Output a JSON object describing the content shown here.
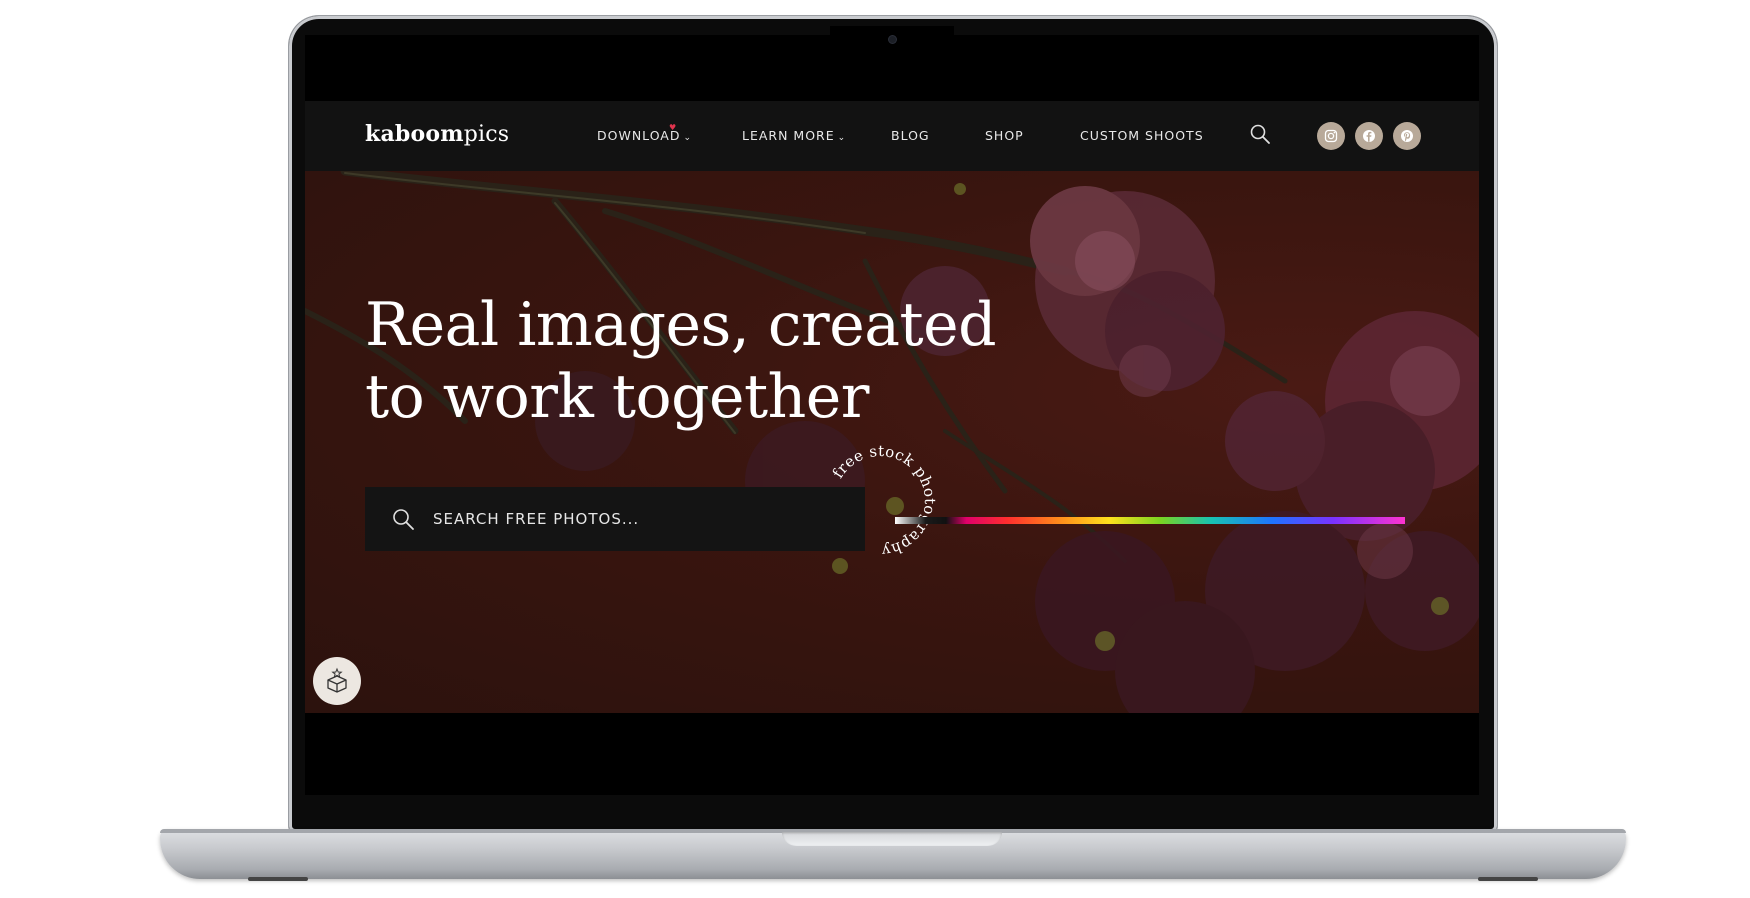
{
  "brand": {
    "logo_bold": "kaboom",
    "logo_light": "pics"
  },
  "nav": {
    "items": [
      {
        "label": "DOWNLOAD",
        "has_dropdown": true
      },
      {
        "label": "LEARN MORE",
        "has_dropdown": true
      },
      {
        "label": "BLOG",
        "has_dropdown": false
      },
      {
        "label": "SHOP",
        "has_dropdown": false
      },
      {
        "label": "CUSTOM SHOOTS",
        "has_dropdown": false
      }
    ],
    "search_icon": "search-icon",
    "social": [
      {
        "name": "instagram-icon"
      },
      {
        "name": "facebook-icon"
      },
      {
        "name": "pinterest-icon"
      }
    ]
  },
  "hero": {
    "headline_line1": "Real images, created",
    "headline_line2": "to work together",
    "search_placeholder": "SEARCH FREE PHOTOS...",
    "badge_text": "free stock photography"
  },
  "colors": {
    "nav_bg": "#121212",
    "hero_bg": "#3a150f",
    "social_bg": "#b8a999",
    "accent_heart": "#e0334d"
  }
}
